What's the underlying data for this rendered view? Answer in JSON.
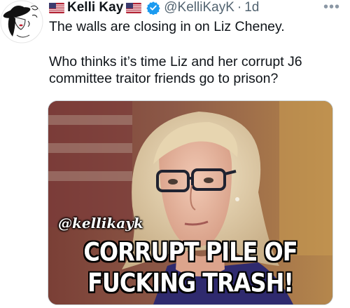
{
  "tweet": {
    "author_name": "Kelli Kay",
    "handle": "@KelliKayK",
    "separator": "·",
    "time": "1d",
    "more_glyph": "•••",
    "text_line_1": "The walls are closing in on Liz Cheney.",
    "text_line_2": "Who thinks it’s time Liz and her corrupt J6 committee traitor friends go to prison?",
    "verified_color": "#1d9bf0"
  },
  "media": {
    "watermark": "@kellikayk",
    "caption_line_1": "CORRUPT PILE OF",
    "caption_line_2": "FUCKING TRASH!"
  },
  "icons": [
    "avatar",
    "us-flag-icon",
    "verified-badge-icon",
    "more-icon"
  ]
}
